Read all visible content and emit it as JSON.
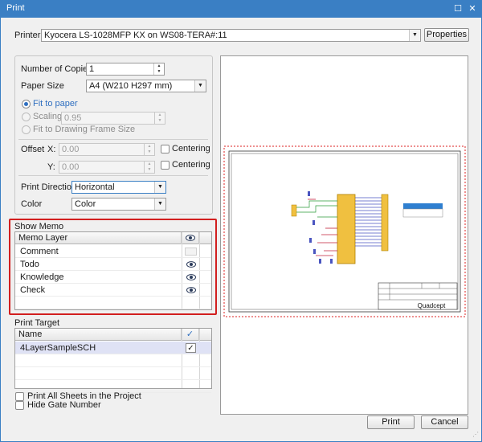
{
  "window": {
    "title": "Print"
  },
  "printer": {
    "label": "Printer",
    "value": "Kyocera LS-1028MFP KX on WS08-TERA#:11",
    "properties_label": "Properties"
  },
  "settings": {
    "copies_label": "Number of Copies",
    "copies_value": "1",
    "paper_label": "Paper Size",
    "paper_value": "A4 (W210 H297 mm)",
    "fit_to_paper": "Fit to paper",
    "scaling": "Scaling",
    "scaling_value": "0.95",
    "fit_frame": "Fit to Drawing Frame Size",
    "offset_label": "Offset",
    "x_label": "X:",
    "x_value": "0.00",
    "y_label": "Y:",
    "y_value": "0.00",
    "centering_x": "Centering",
    "centering_y": "Centering",
    "direction_label": "Print Direction",
    "direction_value": "Horizontal",
    "color_label": "Color",
    "color_value": "Color"
  },
  "show_memo": {
    "title": "Show Memo",
    "header": "Memo Layer",
    "rows": [
      {
        "name": "Comment",
        "visible": false
      },
      {
        "name": "Todo",
        "visible": true
      },
      {
        "name": "Knowledge",
        "visible": true
      },
      {
        "name": "Check",
        "visible": true
      }
    ]
  },
  "print_target": {
    "title": "Print Target",
    "header": "Name",
    "rows": [
      {
        "name": "4LayerSampleSCH",
        "checked": true
      }
    ]
  },
  "options": {
    "all_sheets": "Print All Sheets in the Project",
    "hide_gate": "Hide Gate Number"
  },
  "buttons": {
    "print": "Print",
    "cancel": "Cancel"
  },
  "preview": {
    "title_block_name": "Quadcept"
  },
  "colors": {
    "accent": "#3a7fc4",
    "highlight": "#d21f1f",
    "selected_row": "#dfe2f5"
  },
  "icons": {
    "close": "close-icon",
    "maximize": "maximize-icon",
    "eye": "eye-icon",
    "check": "check-icon"
  }
}
